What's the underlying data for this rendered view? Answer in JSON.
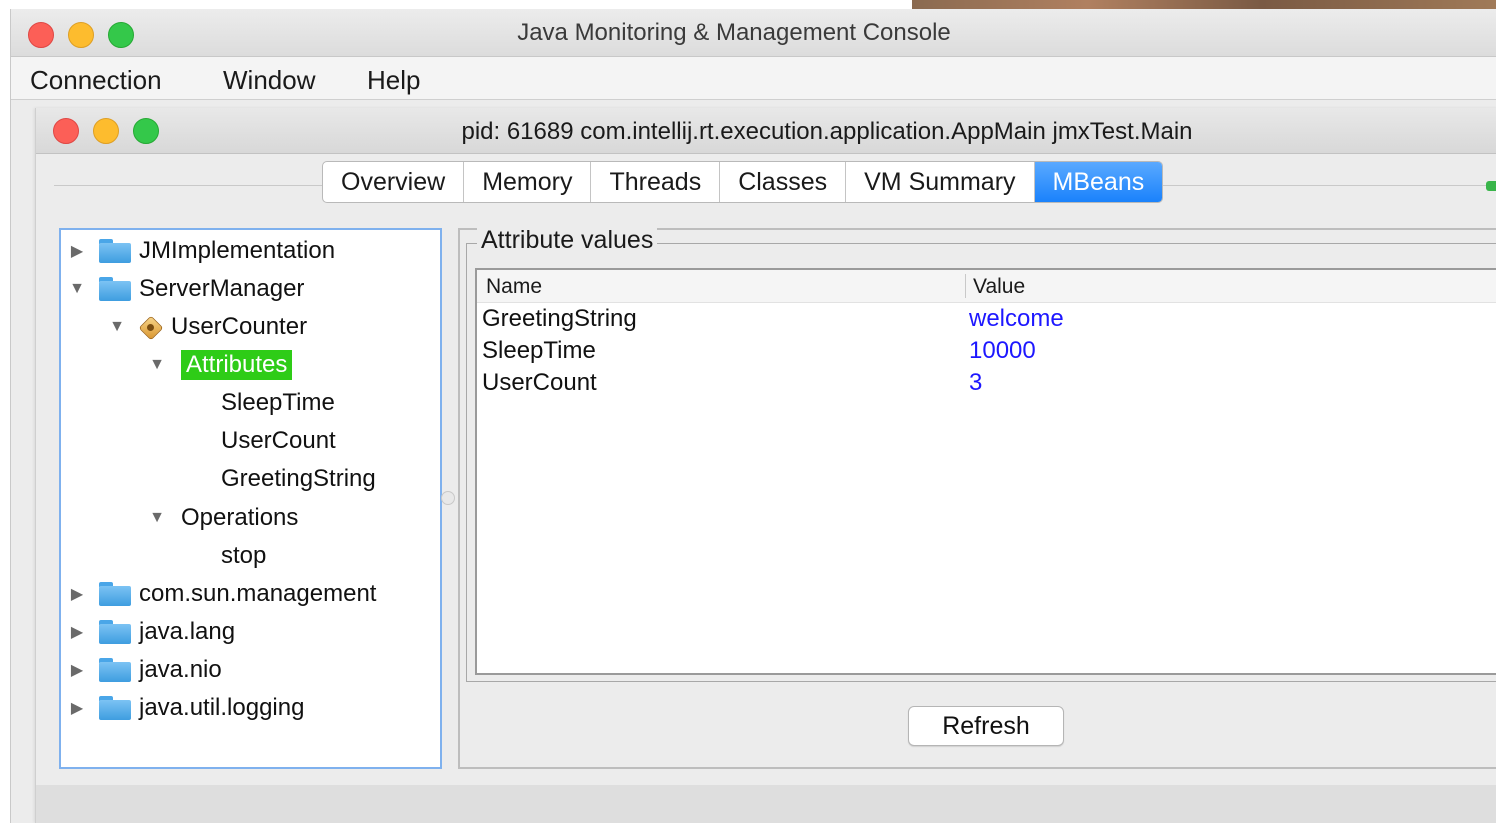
{
  "outer_window": {
    "title": "Java Monitoring & Management Console"
  },
  "menu": {
    "items": [
      "Connection",
      "Window",
      "Help"
    ]
  },
  "inner_window": {
    "title": "pid: 61689 com.intellij.rt.execution.application.AppMain jmxTest.Main"
  },
  "tabs": [
    {
      "label": "Overview",
      "active": false
    },
    {
      "label": "Memory",
      "active": false
    },
    {
      "label": "Threads",
      "active": false
    },
    {
      "label": "Classes",
      "active": false
    },
    {
      "label": "VM Summary",
      "active": false
    },
    {
      "label": "MBeans",
      "active": true
    }
  ],
  "tree": {
    "nodes": [
      {
        "label": "JMImplementation",
        "arrow": "right",
        "icon": "folder-icon"
      },
      {
        "label": "ServerManager",
        "arrow": "down",
        "icon": "folder-icon"
      },
      {
        "label": "UserCounter",
        "arrow": "down",
        "icon": "mbean-icon"
      },
      {
        "label": "Attributes",
        "arrow": "down",
        "icon": "",
        "selected": true
      },
      {
        "label": "SleepTime",
        "arrow": "",
        "icon": ""
      },
      {
        "label": "UserCount",
        "arrow": "",
        "icon": ""
      },
      {
        "label": "GreetingString",
        "arrow": "",
        "icon": ""
      },
      {
        "label": "Operations",
        "arrow": "down",
        "icon": ""
      },
      {
        "label": "stop",
        "arrow": "",
        "icon": ""
      },
      {
        "label": "com.sun.management",
        "arrow": "right",
        "icon": "folder-icon"
      },
      {
        "label": "java.lang",
        "arrow": "right",
        "icon": "folder-icon"
      },
      {
        "label": "java.nio",
        "arrow": "right",
        "icon": "folder-icon"
      },
      {
        "label": "java.util.logging",
        "arrow": "right",
        "icon": "folder-icon"
      }
    ]
  },
  "attributes": {
    "group_title": "Attribute values",
    "columns": [
      "Name",
      "Value"
    ],
    "rows": [
      {
        "name": "GreetingString",
        "value": "welcome"
      },
      {
        "name": "SleepTime",
        "value": "10000"
      },
      {
        "name": "UserCount",
        "value": "3"
      }
    ],
    "value_color": "#1d17ff"
  },
  "buttons": {
    "refresh": "Refresh"
  },
  "colors": {
    "selection": "#2ecc17",
    "active_tab": "#1a82fb"
  }
}
